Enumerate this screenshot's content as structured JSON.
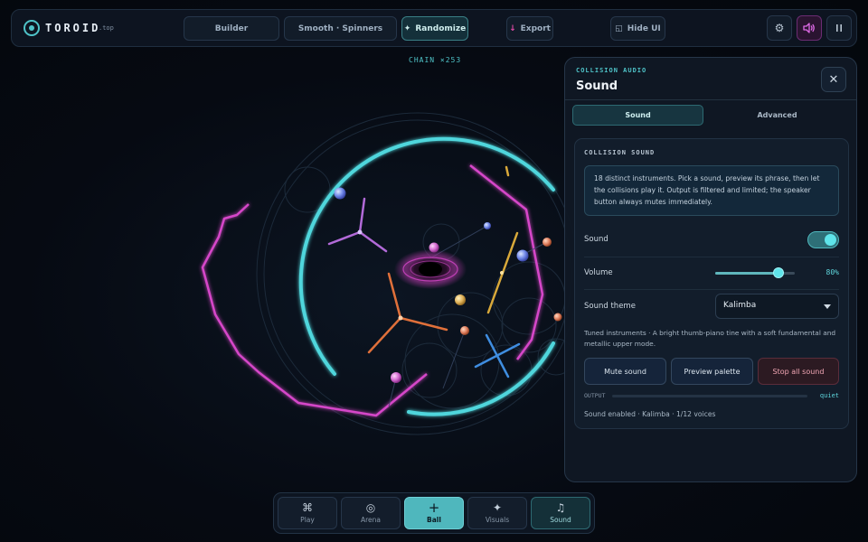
{
  "brand": {
    "name": "TOROID",
    "suffix": ".top"
  },
  "toolbar": {
    "builder": "Builder",
    "preset": "Smooth · Spinners",
    "randomize": "Randomize",
    "export": "Export",
    "hide_ui": "Hide UI",
    "icons": {
      "settings": "gear-icon",
      "sound": "speaker-icon",
      "pause": "pause-icon"
    }
  },
  "scene": {
    "chain_label": "CHAIN ×253"
  },
  "panel": {
    "kicker": "COLLISION AUDIO",
    "title": "Sound",
    "close": "✕",
    "tabs": [
      {
        "label": "Sound",
        "active": true
      },
      {
        "label": "Advanced",
        "active": false
      }
    ],
    "section": {
      "heading": "COLLISION SOUND",
      "info": "18 distinct instruments. Pick a sound, preview its phrase, then let the collisions play it. Output is filtered and limited; the speaker button always mutes immediately.",
      "sound_label": "Sound",
      "sound_on": true,
      "volume_label": "Volume",
      "volume": 80,
      "volume_text": "80%",
      "theme_label": "Sound theme",
      "theme_value": "Kalimba",
      "theme_desc": "Tuned instruments · A bright thumb-piano tine with a soft fundamental and metallic upper mode.",
      "buttons": {
        "mute": "Mute sound",
        "preview": "Preview palette",
        "stop": "Stop all sound"
      },
      "output_label": "OUTPUT",
      "output_level": "quiet",
      "status": "Sound enabled · Kalimba · 1/12 voices"
    }
  },
  "dock": [
    {
      "label": "Play",
      "glyph": "⌘",
      "icon": "command-icon"
    },
    {
      "label": "Arena",
      "glyph": "◎",
      "icon": "target-icon"
    },
    {
      "label": "Ball",
      "glyph": "+",
      "icon": "plus-icon"
    },
    {
      "label": "Visuals",
      "glyph": "✦",
      "icon": "sparkle-icon"
    },
    {
      "label": "Sound",
      "glyph": "♫",
      "icon": "music-icon"
    }
  ],
  "colors": {
    "accent": "#4fc3c8",
    "magenta": "#d646c9",
    "orange": "#e0703a",
    "gold": "#d9a93a",
    "blue": "#3f8de0",
    "danger": "#f0a5b3"
  }
}
